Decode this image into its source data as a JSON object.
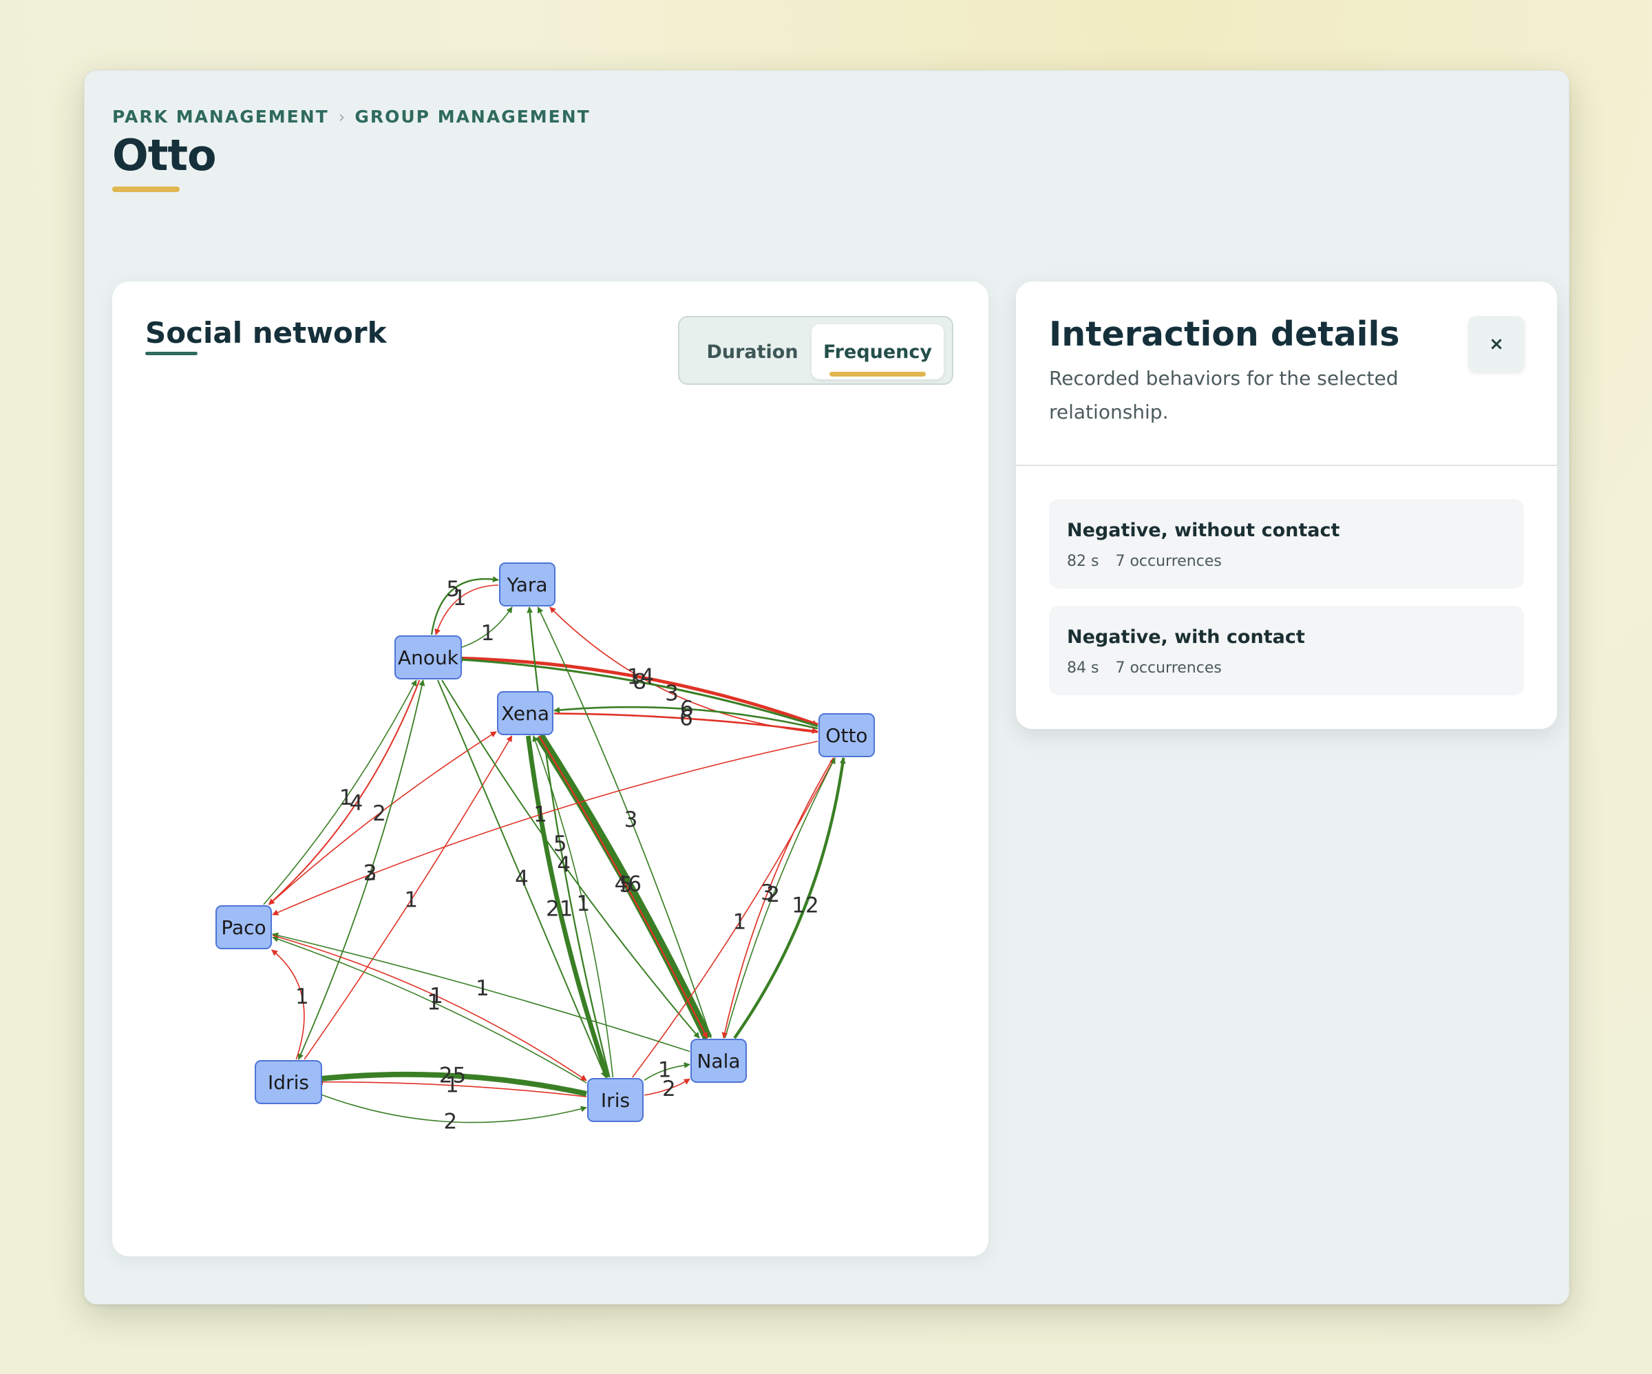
{
  "breadcrumb": [
    "PARK MANAGEMENT",
    "GROUP MANAGEMENT"
  ],
  "breadcrumb_separator": "›",
  "page_title": "Otto",
  "network_panel": {
    "title": "Social network",
    "toggle": {
      "options": [
        "Duration",
        "Frequency"
      ],
      "selected": "Frequency"
    }
  },
  "details_panel": {
    "title": "Interaction details",
    "subtitle": "Recorded behaviors for the selected relationship.",
    "close_label": "×",
    "behaviors": [
      {
        "name": "Negative, without contact",
        "duration": "82 s",
        "occurrences": "7 occurrences"
      },
      {
        "name": "Negative, with contact",
        "duration": "84 s",
        "occurrences": "7 occurrences"
      }
    ]
  },
  "colors": {
    "positive_edge": "#3a7f25",
    "negative_edge": "#e03226",
    "node_fill": "#9ebcf6",
    "node_stroke": "#4d74d6",
    "accent": "#e0b64e",
    "brand": "#2f6a5e"
  },
  "graph": {
    "nodes": [
      "Yara",
      "Anouk",
      "Xena",
      "Otto",
      "Paco",
      "Nala",
      "Idris",
      "Iris"
    ],
    "edges": [
      {
        "from": "Anouk",
        "to": "Yara",
        "weight": 5,
        "kind": "positive"
      },
      {
        "from": "Yara",
        "to": "Anouk",
        "weight": 1,
        "kind": "negative"
      },
      {
        "from": "Anouk",
        "to": "Yara",
        "weight": 1,
        "kind": "positive"
      },
      {
        "from": "Otto",
        "to": "Yara",
        "weight": 3,
        "kind": "negative"
      },
      {
        "from": "Anouk",
        "to": "Otto",
        "weight": 14,
        "kind": "negative"
      },
      {
        "from": "Otto",
        "to": "Anouk",
        "weight": 8,
        "kind": "positive"
      },
      {
        "from": "Otto",
        "to": "Xena",
        "weight": 6,
        "kind": "positive"
      },
      {
        "from": "Xena",
        "to": "Otto",
        "weight": 6,
        "kind": "negative"
      },
      {
        "from": "Anouk",
        "to": "Paco",
        "weight": 4,
        "kind": "negative"
      },
      {
        "from": "Paco",
        "to": "Anouk",
        "weight": 1,
        "kind": "positive"
      },
      {
        "from": "Paco",
        "to": "Xena",
        "weight": 2,
        "kind": "negative"
      },
      {
        "from": "Idris",
        "to": "Anouk",
        "weight": 2,
        "kind": "positive"
      },
      {
        "from": "Anouk",
        "to": "Idris",
        "weight": 3,
        "kind": "positive"
      },
      {
        "from": "Idris",
        "to": "Xena",
        "weight": 1,
        "kind": "negative"
      },
      {
        "from": "Anouk",
        "to": "Iris",
        "weight": 4,
        "kind": "positive"
      },
      {
        "from": "Xena",
        "to": "Iris",
        "weight": 21,
        "kind": "positive"
      },
      {
        "from": "Iris",
        "to": "Yara",
        "weight": 5,
        "kind": "positive"
      },
      {
        "from": "Nala",
        "to": "Yara",
        "weight": 3,
        "kind": "positive"
      },
      {
        "from": "Nala",
        "to": "Xena",
        "weight": 46,
        "kind": "positive"
      },
      {
        "from": "Xena",
        "to": "Nala",
        "weight": 5,
        "kind": "negative"
      },
      {
        "from": "Iris",
        "to": "Xena",
        "weight": 1,
        "kind": "positive"
      },
      {
        "from": "Anouk",
        "to": "Nala",
        "weight": 4,
        "kind": "positive"
      },
      {
        "from": "Iris",
        "to": "Otto",
        "weight": 1,
        "kind": "negative"
      },
      {
        "from": "Nala",
        "to": "Otto",
        "weight": 2,
        "kind": "positive"
      },
      {
        "from": "Otto",
        "to": "Nala",
        "weight": 3,
        "kind": "negative"
      },
      {
        "from": "Nala",
        "to": "Otto",
        "weight": 12,
        "kind": "positive"
      },
      {
        "from": "Otto",
        "to": "Paco",
        "weight": 1,
        "kind": "negative"
      },
      {
        "from": "Idris",
        "to": "Paco",
        "weight": 1,
        "kind": "negative"
      },
      {
        "from": "Nala",
        "to": "Paco",
        "weight": 1,
        "kind": "positive"
      },
      {
        "from": "Iris",
        "to": "Paco",
        "weight": 1,
        "kind": "positive"
      },
      {
        "from": "Paco",
        "to": "Iris",
        "weight": 1,
        "kind": "negative"
      },
      {
        "from": "Iris",
        "to": "Idris",
        "weight": 1,
        "kind": "negative"
      },
      {
        "from": "Iris",
        "to": "Idris",
        "weight": 25,
        "kind": "positive"
      },
      {
        "from": "Idris",
        "to": "Iris",
        "weight": 2,
        "kind": "positive"
      },
      {
        "from": "Iris",
        "to": "Nala",
        "weight": 1,
        "kind": "positive"
      },
      {
        "from": "Iris",
        "to": "Nala",
        "weight": 2,
        "kind": "negative"
      }
    ]
  }
}
